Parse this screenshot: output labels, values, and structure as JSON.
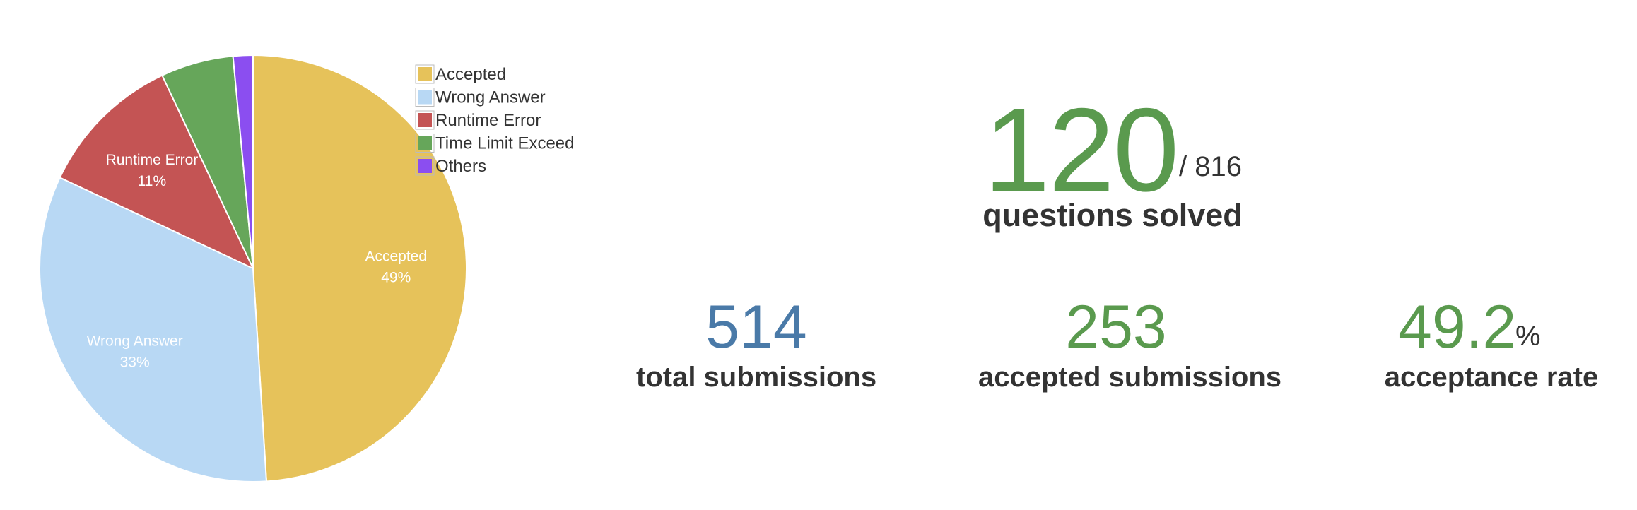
{
  "chart_data": {
    "type": "pie",
    "slices": [
      {
        "label": "Accepted",
        "percent": 49,
        "color": "#e6c25a",
        "display_label": "Accepted",
        "display_percent": "49%"
      },
      {
        "label": "Wrong Answer",
        "percent": 33,
        "color": "#b8d8f4",
        "display_label": "Wrong Answer",
        "display_percent": "33%"
      },
      {
        "label": "Runtime Error",
        "percent": 11,
        "color": "#c45454",
        "display_label": "Runtime Error",
        "display_percent": "11%"
      },
      {
        "label": "Time Limit Exceed",
        "percent": 5.5,
        "color": "#66a65a",
        "display_label": "",
        "display_percent": ""
      },
      {
        "label": "Others",
        "percent": 1.5,
        "color": "#8b4ef0",
        "display_label": "",
        "display_percent": ""
      }
    ],
    "legend": [
      "Accepted",
      "Wrong Answer",
      "Runtime Error",
      "Time Limit Exceed",
      "Others"
    ],
    "legend_position": "top-right"
  },
  "stats": {
    "solved": {
      "value": "120",
      "total": "/ 816",
      "label": "questions solved",
      "color": "#5a9a4e"
    },
    "total_submissions": {
      "value": "514",
      "label": "total submissions",
      "color": "#4a7aa8"
    },
    "accepted_submissions": {
      "value": "253",
      "label": "accepted submissions",
      "color": "#5a9a4e"
    },
    "acceptance_rate": {
      "value": "49.2",
      "suffix": "%",
      "label": "acceptance rate",
      "color": "#5a9a4e"
    }
  }
}
